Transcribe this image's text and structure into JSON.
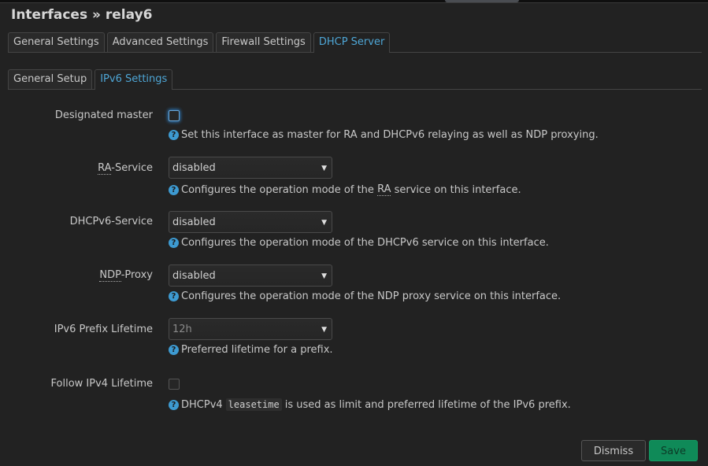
{
  "header": {
    "title": "Interfaces » relay6"
  },
  "main_tabs": [
    {
      "label": "General Settings",
      "active": false
    },
    {
      "label": "Advanced Settings",
      "active": false
    },
    {
      "label": "Firewall Settings",
      "active": false
    },
    {
      "label": "DHCP Server",
      "active": true
    }
  ],
  "sub_tabs": [
    {
      "label": "General Setup",
      "active": false
    },
    {
      "label": "IPv6 Settings",
      "active": true
    }
  ],
  "fields": {
    "designated_master": {
      "label": "Designated master",
      "checked": false,
      "help": "Set this interface as master for RA and DHCPv6 relaying as well as NDP proxying."
    },
    "ra_service": {
      "label_abbr": "RA",
      "label_rest": "-Service",
      "value": "disabled",
      "help_pre": "Configures the operation mode of the ",
      "help_abbr": "RA",
      "help_post": " service on this interface."
    },
    "dhcpv6_service": {
      "label": "DHCPv6-Service",
      "value": "disabled",
      "help": "Configures the operation mode of the DHCPv6 service on this interface."
    },
    "ndp_proxy": {
      "label_abbr": "NDP",
      "label_rest": "-Proxy",
      "value": "disabled",
      "help": "Configures the operation mode of the NDP proxy service on this interface."
    },
    "ipv6_prefix_lifetime": {
      "label": "IPv6 Prefix Lifetime",
      "placeholder": "12h",
      "help": "Preferred lifetime for a prefix."
    },
    "follow_ipv4_lifetime": {
      "label": "Follow IPv4 Lifetime",
      "checked": false,
      "help_pre": "DHCPv4",
      "help_code": "leasetime",
      "help_post": "is used as limit and preferred lifetime of the IPv6 prefix."
    }
  },
  "icons": {
    "help": "?",
    "dropdown": "▼"
  },
  "footer": {
    "dismiss_label": "Dismiss",
    "save_label": "Save"
  },
  "colors": {
    "accent": "#4ea6d6",
    "save": "#0f8a58",
    "background": "#222222"
  }
}
